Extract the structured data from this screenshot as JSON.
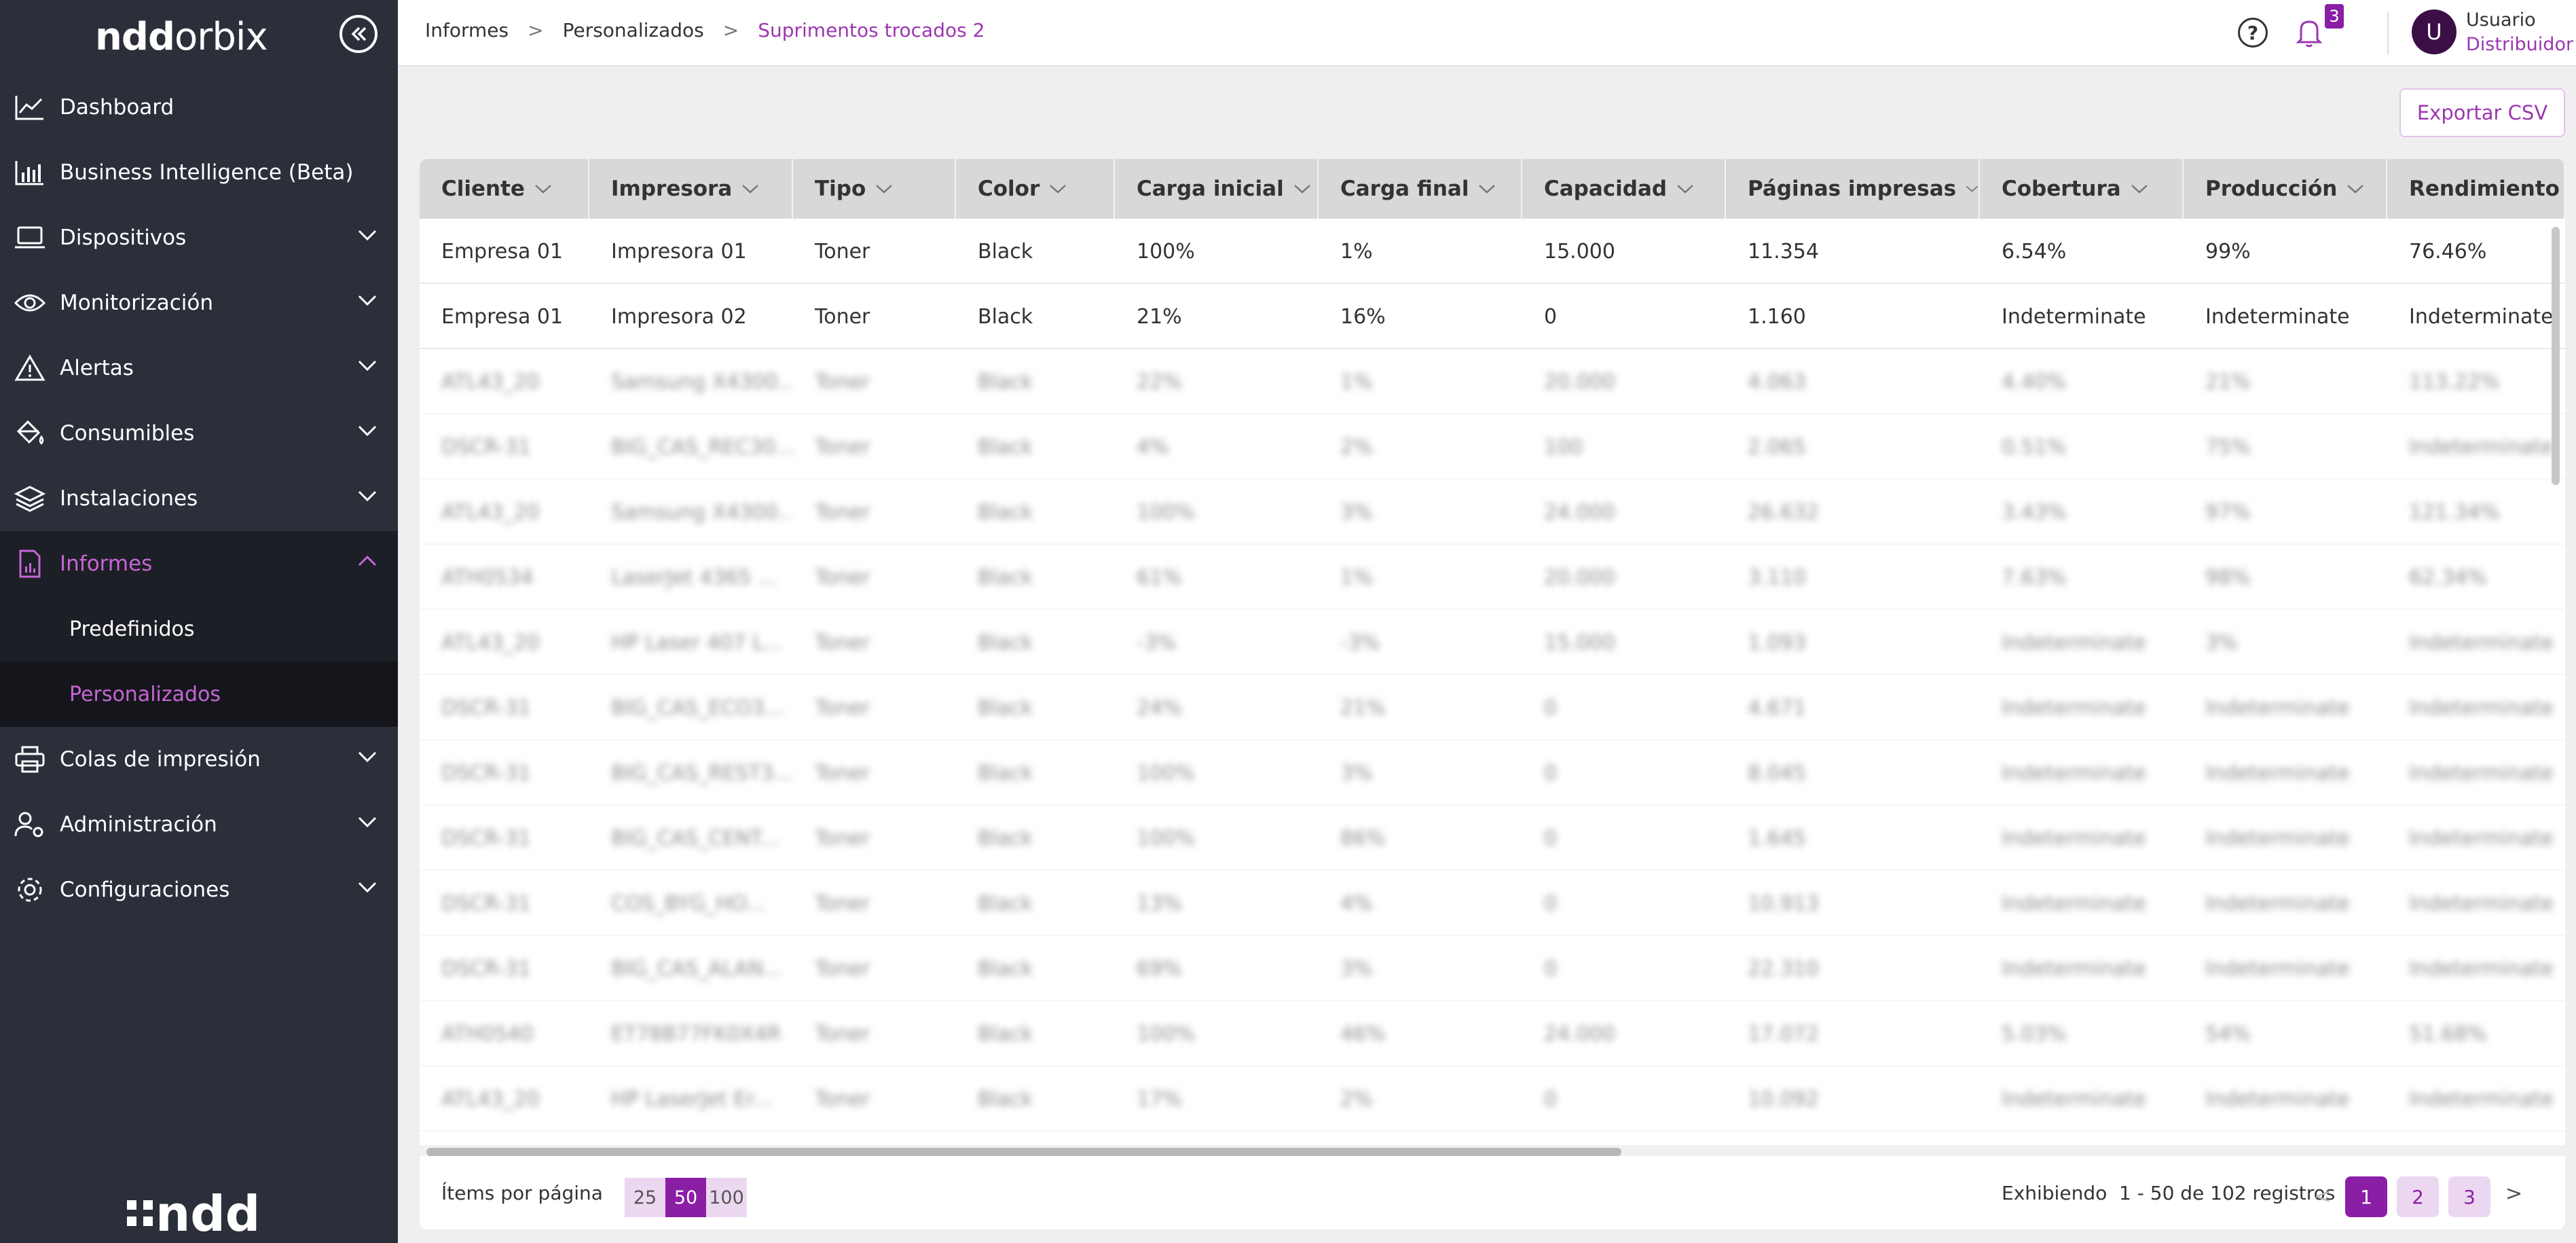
{
  "brand": {
    "logo_bold": "ndd",
    "logo_light": "orbix",
    "footer_logo": "ndd"
  },
  "sidebar": {
    "items": [
      {
        "label": "Dashboard",
        "icon": "chart-line-icon"
      },
      {
        "label": "Business Intelligence (Beta)",
        "icon": "bar-chart-icon"
      },
      {
        "label": "Dispositivos",
        "icon": "laptop-icon"
      },
      {
        "label": "Monitorización",
        "icon": "eye-icon"
      },
      {
        "label": "Alertas",
        "icon": "warning-icon"
      },
      {
        "label": "Consumibles",
        "icon": "paint-bucket-icon"
      },
      {
        "label": "Instalaciones",
        "icon": "layers-icon"
      },
      {
        "label": "Informes",
        "icon": "report-icon"
      },
      {
        "label": "Colas de impresión",
        "icon": "printer-icon"
      },
      {
        "label": "Administración",
        "icon": "user-gear-icon"
      },
      {
        "label": "Configuraciones",
        "icon": "gear-icon"
      }
    ],
    "sub_items": [
      {
        "label": "Predefinidos"
      },
      {
        "label": "Personalizados"
      }
    ]
  },
  "breadcrumb": [
    "Informes",
    "Personalizados",
    "Suprimentos trocados 2"
  ],
  "header": {
    "help_icon": "?",
    "notification_count": "3",
    "avatar_letter": "U",
    "user_name": "Usuario",
    "user_role": "Distribuidor"
  },
  "export_label": "Exportar CSV",
  "table": {
    "columns": [
      "Cliente",
      "Impresora",
      "Tipo",
      "Color",
      "Carga inicial",
      "Carga final",
      "Capacidad",
      "Páginas impresas",
      "Cobertura",
      "Producción",
      "Rendimiento"
    ],
    "rows": [
      [
        "Empresa 01",
        "Impresora 01",
        "Toner",
        "Black",
        "100%",
        "1%",
        "15.000",
        "11.354",
        "6.54%",
        "99%",
        "76.46%"
      ],
      [
        "Empresa 01",
        "Impresora 02",
        "Toner",
        "Black",
        "21%",
        "16%",
        "0",
        "1.160",
        "Indeterminate",
        "Indeterminate",
        "Indeterminate"
      ]
    ],
    "blurred_rows": [
      [
        "ATL43_20",
        "Samsung X4300...",
        "Toner",
        "Black",
        "22%",
        "1%",
        "20.000",
        "4.063",
        "4.40%",
        "21%",
        "113.22%"
      ],
      [
        "DSCR-31",
        "BIG_CAS_REC30...",
        "Toner",
        "Black",
        "4%",
        "2%",
        "100",
        "2.065",
        "0.51%",
        "75%",
        "Indeterminate"
      ],
      [
        "ATL43_20",
        "Samsung X4300...",
        "Toner",
        "Black",
        "100%",
        "3%",
        "24.000",
        "26.632",
        "3.43%",
        "97%",
        "121.34%"
      ],
      [
        "ATH0534",
        "LaserJet 4365 ...",
        "Toner",
        "Black",
        "61%",
        "1%",
        "20.000",
        "3.110",
        "7.63%",
        "98%",
        "62.34%"
      ],
      [
        "ATL43_20",
        "HP Laser 407 L...",
        "Toner",
        "Black",
        "-3%",
        "-3%",
        "15.000",
        "1.093",
        "Indeterminate",
        "3%",
        "Indeterminate"
      ],
      [
        "DSCR-31",
        "BIG_CAS_ECO3...",
        "Toner",
        "Black",
        "24%",
        "21%",
        "0",
        "4.671",
        "Indeterminate",
        "Indeterminate",
        "Indeterminate"
      ],
      [
        "DSCR-31",
        "BIG_CAS_REST3...",
        "Toner",
        "Black",
        "100%",
        "3%",
        "0",
        "8.045",
        "Indeterminate",
        "Indeterminate",
        "Indeterminate"
      ],
      [
        "DSCR-31",
        "BIG_CAS_CENT...",
        "Toner",
        "Black",
        "100%",
        "86%",
        "0",
        "1.645",
        "Indeterminate",
        "Indeterminate",
        "Indeterminate"
      ],
      [
        "DSCR-31",
        "COS_BYG_HO...",
        "Toner",
        "Black",
        "13%",
        "4%",
        "0",
        "10.913",
        "Indeterminate",
        "Indeterminate",
        "Indeterminate"
      ],
      [
        "DSCR-31",
        "BIG_CAS_ALAN...",
        "Toner",
        "Black",
        "69%",
        "3%",
        "0",
        "22.310",
        "Indeterminate",
        "Indeterminate",
        "Indeterminate"
      ],
      [
        "ATH0540",
        "ET78B77FK0X4R",
        "Toner",
        "Black",
        "100%",
        "46%",
        "24.000",
        "17.072",
        "5.03%",
        "54%",
        "51.68%"
      ],
      [
        "ATL43_20",
        "HP LaserJet Er...",
        "Toner",
        "Black",
        "17%",
        "2%",
        "0",
        "10.092",
        "Indeterminate",
        "Indeterminate",
        "Indeterminate"
      ]
    ]
  },
  "pagination": {
    "per_page_label": "Ítems por página",
    "options": [
      "25",
      "50",
      "100"
    ],
    "selected_option": "50",
    "showing_prefix": "Exhibiendo",
    "showing_range": "1 - 50 de 102 registros",
    "pages": [
      "1",
      "2",
      "3"
    ],
    "current_page": "1"
  },
  "colors": {
    "accent": "#8a1fa6",
    "accent_light": "#ecd7f1",
    "sidebar_bg": "#2b2f3a",
    "sidebar_active_text": "#c566d6"
  }
}
